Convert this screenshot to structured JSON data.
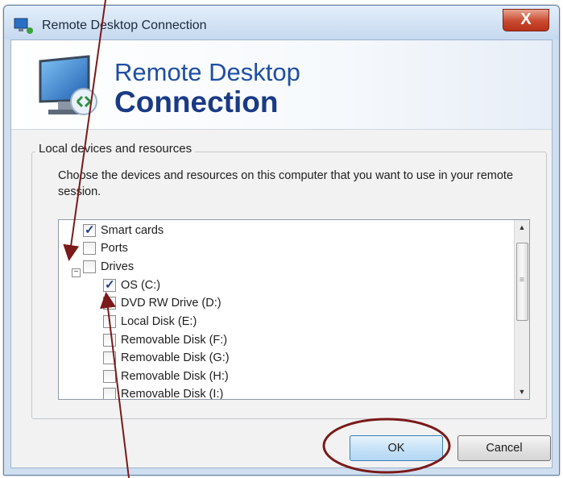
{
  "window": {
    "title": "Remote Desktop Connection",
    "close_label": "X"
  },
  "banner": {
    "line1": "Remote Desktop",
    "line2": "Connection"
  },
  "local_resources": {
    "group_label": "Local devices and resources",
    "description": "Choose the devices and resources on this computer that you want to use in your remote session.",
    "items": [
      {
        "label": "Smart cards",
        "checked": true
      },
      {
        "label": "Ports",
        "checked": false
      },
      {
        "label": "Drives",
        "checked": false,
        "expanded": true
      },
      {
        "label": "OS (C:)",
        "checked": true
      },
      {
        "label": "DVD RW Drive (D:)",
        "checked": false
      },
      {
        "label": "Local Disk (E:)",
        "checked": false
      },
      {
        "label": "Removable Disk (F:)",
        "checked": false
      },
      {
        "label": "Removable Disk (G:)",
        "checked": false
      },
      {
        "label": "Removable Disk (H:)",
        "checked": false
      },
      {
        "label": "Removable Disk (I:)",
        "checked": false
      }
    ]
  },
  "buttons": {
    "ok": "OK",
    "cancel": "Cancel"
  },
  "colors": {
    "annotation": "#7a1a1a",
    "title_text": "#1f4fa3"
  }
}
